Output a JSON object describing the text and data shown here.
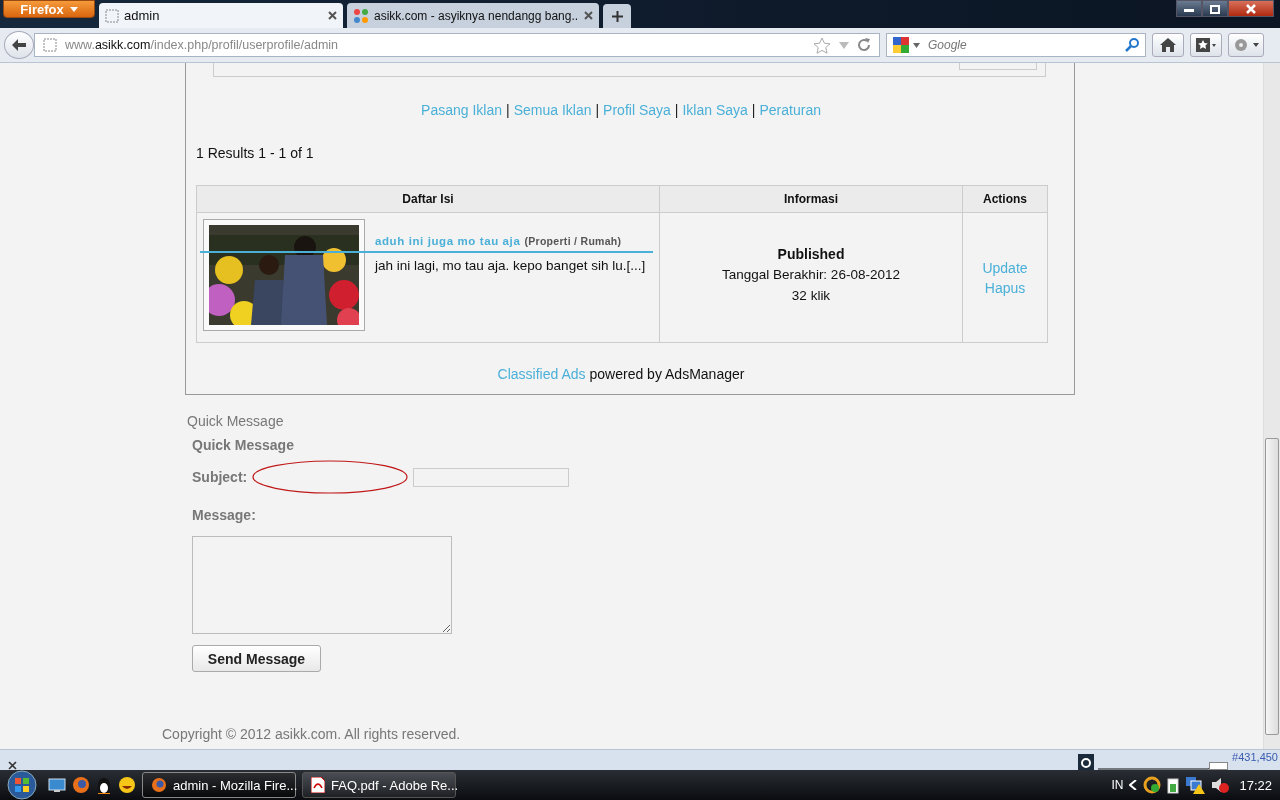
{
  "browser": {
    "brand": "Firefox",
    "tabs": [
      {
        "title": "admin",
        "selected": true
      },
      {
        "title": "asikk.com - asyiknya nendangg bang...",
        "selected": false
      }
    ],
    "url": "www.**asikk.com**/index.php/profil/userprofile/admin",
    "search": {
      "placeholder": "Google"
    }
  },
  "page": {
    "nav_links": [
      "Pasang Iklan",
      "Semua Iklan",
      "Profil Saya",
      "Iklan Saya",
      "Peraturan"
    ],
    "nav_separator": "|",
    "results": "1 Results 1 - 1 of 1",
    "table": {
      "columns": [
        "Daftar Isi",
        "Informasi",
        "Actions"
      ],
      "rows": [
        {
          "image": {
            "kind": "picture"
          },
          "title": "aduh ini juga mo tau aja",
          "category": "(Properti / Rumah)",
          "excerpt": "jah ini lagi, mo tau aja. kepo banget sih lu.[...]",
          "status": "Published",
          "expiry": "Tanggal Berakhir: 26-08-2012",
          "clicks": "32 klik",
          "actions": [
            "Update",
            "Hapus"
          ]
        }
      ]
    },
    "credit": {
      "link": "Classified Ads",
      "text": "powered by AdsManager"
    },
    "quick_message": {
      "section_title": "Quick Message",
      "form_title": "Quick Message",
      "subject_label": "Subject:",
      "message_label": "Message:",
      "button": "Send Message"
    },
    "copyright": "Copyright © 2012 asikk.com. All rights reserved."
  },
  "status_bar": {
    "rank": "#431,450"
  },
  "taskbar": {
    "windows": [
      {
        "title": "admin - Mozilla Fire...",
        "selected": true
      },
      {
        "title": "FAQ.pdf - Adobe Re...",
        "selected": false
      }
    ],
    "language": "IN",
    "time": "17:22"
  }
}
